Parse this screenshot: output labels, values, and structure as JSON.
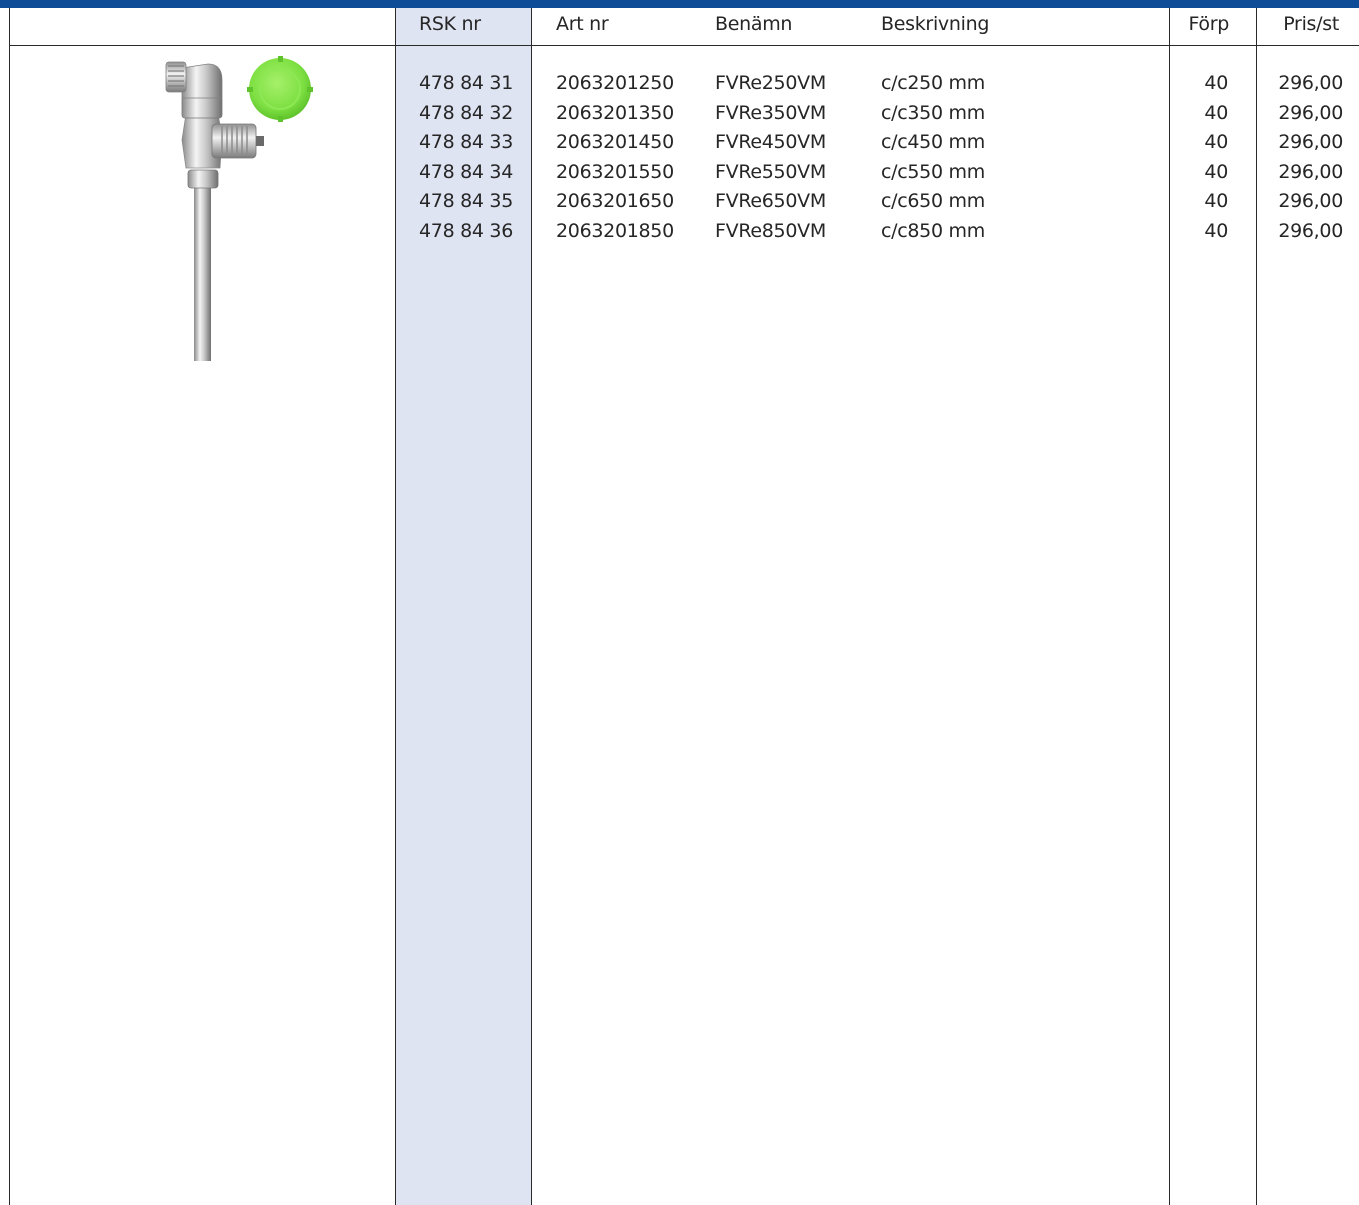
{
  "table": {
    "headers": {
      "rsk": "RSK nr",
      "art": "Art nr",
      "benamn": "Benämn",
      "beskrivning": "Beskrivning",
      "forp": "Förp",
      "pris": "Pris/st"
    },
    "rows": [
      {
        "rsk": "478 84 31",
        "art": "2063201250",
        "benamn": "FVRe250VM",
        "beskrivning": "c/c250 mm",
        "forp": "40",
        "pris": "296,00"
      },
      {
        "rsk": "478 84 32",
        "art": "2063201350",
        "benamn": "FVRe350VM",
        "beskrivning": "c/c350 mm",
        "forp": "40",
        "pris": "296,00"
      },
      {
        "rsk": "478 84 33",
        "art": "2063201450",
        "benamn": "FVRe450VM",
        "beskrivning": "c/c450 mm",
        "forp": "40",
        "pris": "296,00"
      },
      {
        "rsk": "478 84 34",
        "art": "2063201550",
        "benamn": "FVRe550VM",
        "beskrivning": "c/c550 mm",
        "forp": "40",
        "pris": "296,00"
      },
      {
        "rsk": "478 84 35",
        "art": "2063201650",
        "benamn": "FVRe650VM",
        "beskrivning": "c/c650 mm",
        "forp": "40",
        "pris": "296,00"
      },
      {
        "rsk": "478 84 36",
        "art": "2063201850",
        "benamn": "FVRe850VM",
        "beskrivning": "c/c850 mm",
        "forp": "40",
        "pris": "296,00"
      }
    ]
  },
  "colors": {
    "header_bar": "#0f4c97",
    "rsk_column_bg": "#dfe4f3",
    "cap_green": "#7ee043"
  },
  "image": {
    "icon": "valve-product-icon"
  }
}
